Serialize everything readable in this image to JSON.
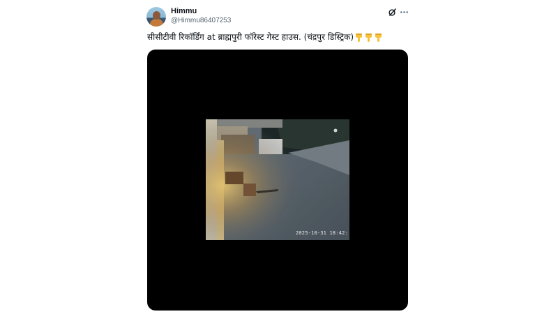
{
  "author": {
    "display_name": "Himmu",
    "handle": "@Himmu86407253"
  },
  "tweet": {
    "text": "सीसीटीवी रिकॉर्डिंग at ब्राह्मपुरी फॉरेस्ट गेस्ट हाउस. (चंद्रपुर डिस्ट्रिक)",
    "emojis": [
      "pointing-down-hand",
      "pointing-down-hand",
      "pointing-down-hand"
    ]
  },
  "media": {
    "overlay_timestamp": "2025-10-31 18:42:"
  },
  "icons": {
    "grok": "grok-icon",
    "more": "more-options-icon"
  },
  "colors": {
    "background": "#ffffff",
    "text": "#0f1419",
    "secondary_text": "#536471",
    "media_background": "#000000",
    "emoji": "#f7c23c"
  }
}
